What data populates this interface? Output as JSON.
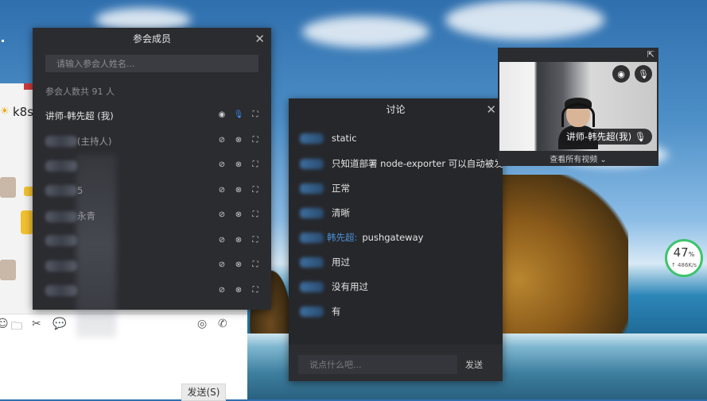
{
  "participants": {
    "title": "参会成员",
    "search_placeholder": "请输入参会人姓名...",
    "count_text": "参会人数共 91 人",
    "members": [
      {
        "name": "讲师-韩先超 (我)",
        "obscured": false,
        "cam": "on",
        "mic": "on"
      },
      {
        "name": "(主持人)",
        "obscured": true,
        "cam": "off",
        "mic": "off"
      },
      {
        "name": "",
        "obscured": true,
        "cam": "off",
        "mic": "off"
      },
      {
        "name": "5",
        "obscured": true,
        "cam": "off",
        "mic": "off"
      },
      {
        "name": "永青",
        "obscured": true,
        "cam": "off",
        "mic": "off"
      },
      {
        "name": "",
        "obscured": true,
        "cam": "off",
        "mic": "off"
      },
      {
        "name": "",
        "obscured": true,
        "cam": "off",
        "mic": "off"
      },
      {
        "name": "",
        "obscured": true,
        "cam": "off",
        "mic": "off"
      }
    ]
  },
  "discussion": {
    "title": "讨论",
    "messages": [
      {
        "sender": "",
        "text": "static"
      },
      {
        "sender": "",
        "text": "只知道部署 node-exporter 可以自动被发"
      },
      {
        "sender": "",
        "text": "正常"
      },
      {
        "sender": "",
        "text": "清晰"
      },
      {
        "sender": "韩先超:",
        "text": "pushgateway"
      },
      {
        "sender": "",
        "text": "用过"
      },
      {
        "sender": "",
        "text": "没有用过"
      },
      {
        "sender": "",
        "text": "有"
      }
    ],
    "input_placeholder": "说点什么吧...",
    "send_label": "发送"
  },
  "video": {
    "name_tag": "讲师-韩先超(我)",
    "view_all": "查看所有视频"
  },
  "chat_app": {
    "title": "k8s",
    "send_label": "发送(S)"
  },
  "network": {
    "percent": "47",
    "percent_unit": "%",
    "speed": "↑ 486K/s"
  },
  "colors": {
    "panel_bg": "#2b2c30",
    "accent_blue": "#3c8cf0",
    "sender_blue": "#4a8fd6",
    "net_green": "#3ec46d"
  }
}
